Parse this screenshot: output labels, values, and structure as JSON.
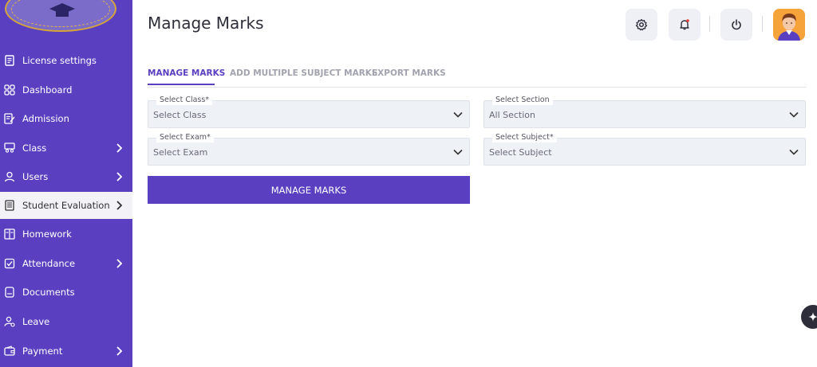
{
  "sidebar": {
    "items": [
      {
        "label": "License settings",
        "icon": "license-icon"
      },
      {
        "label": "Dashboard",
        "icon": "dashboard-icon"
      },
      {
        "label": "Admission",
        "icon": "admission-icon"
      },
      {
        "label": "Class",
        "icon": "class-icon"
      },
      {
        "label": "Users",
        "icon": "users-icon"
      },
      {
        "label": "Student Evaluation",
        "icon": "evaluation-icon"
      },
      {
        "label": "Homework",
        "icon": "homework-icon"
      },
      {
        "label": "Attendance",
        "icon": "attendance-icon"
      },
      {
        "label": "Documents",
        "icon": "documents-icon"
      },
      {
        "label": "Leave",
        "icon": "leave-icon"
      },
      {
        "label": "Payment",
        "icon": "payment-icon"
      }
    ]
  },
  "header": {
    "title": "Manage Marks"
  },
  "tabs": [
    {
      "label": "MANAGE MARKS"
    },
    {
      "label": "ADD MULTIPLE SUBJECT MARKS"
    },
    {
      "label": "EXPORT MARKS"
    }
  ],
  "form": {
    "class": {
      "legend": "Select Class*",
      "value": "Select Class"
    },
    "section": {
      "legend": "Select Section",
      "value": "All Section"
    },
    "exam": {
      "legend": "Select Exam*",
      "value": "Select Exam"
    },
    "subject": {
      "legend": "Select Subject*",
      "value": "Select Subject"
    },
    "submit_label": "MANAGE MARKS"
  },
  "colors": {
    "primary": "#5a3fc0",
    "sidebar_bg": "#5a3fc0",
    "active_item_bg": "#f2f2f7",
    "select_bg": "#eef1f6"
  }
}
